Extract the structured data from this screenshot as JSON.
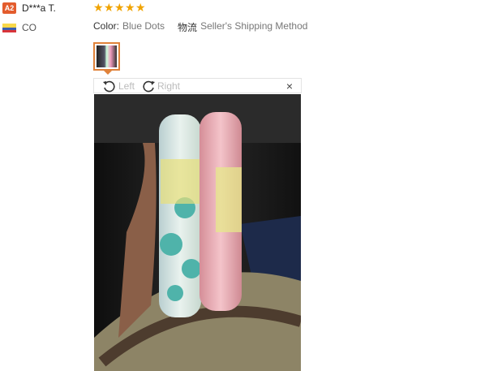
{
  "reviewer": {
    "badge": "A2",
    "name": "D***a T.",
    "country": "CO"
  },
  "review": {
    "rating": 5,
    "stars": [
      "★",
      "★",
      "★",
      "★",
      "★"
    ],
    "color_label": "Color:",
    "color_value": "Blue Dots",
    "shipping_label": "物流",
    "shipping_value": "Seller's Shipping Method"
  },
  "viewer": {
    "rotate_left_label": "Left",
    "rotate_right_label": "Right",
    "close_label": "×"
  },
  "colors": {
    "badge": "#e35c2d",
    "stars": "#f0a300",
    "thumb_border": "#e0823a"
  }
}
